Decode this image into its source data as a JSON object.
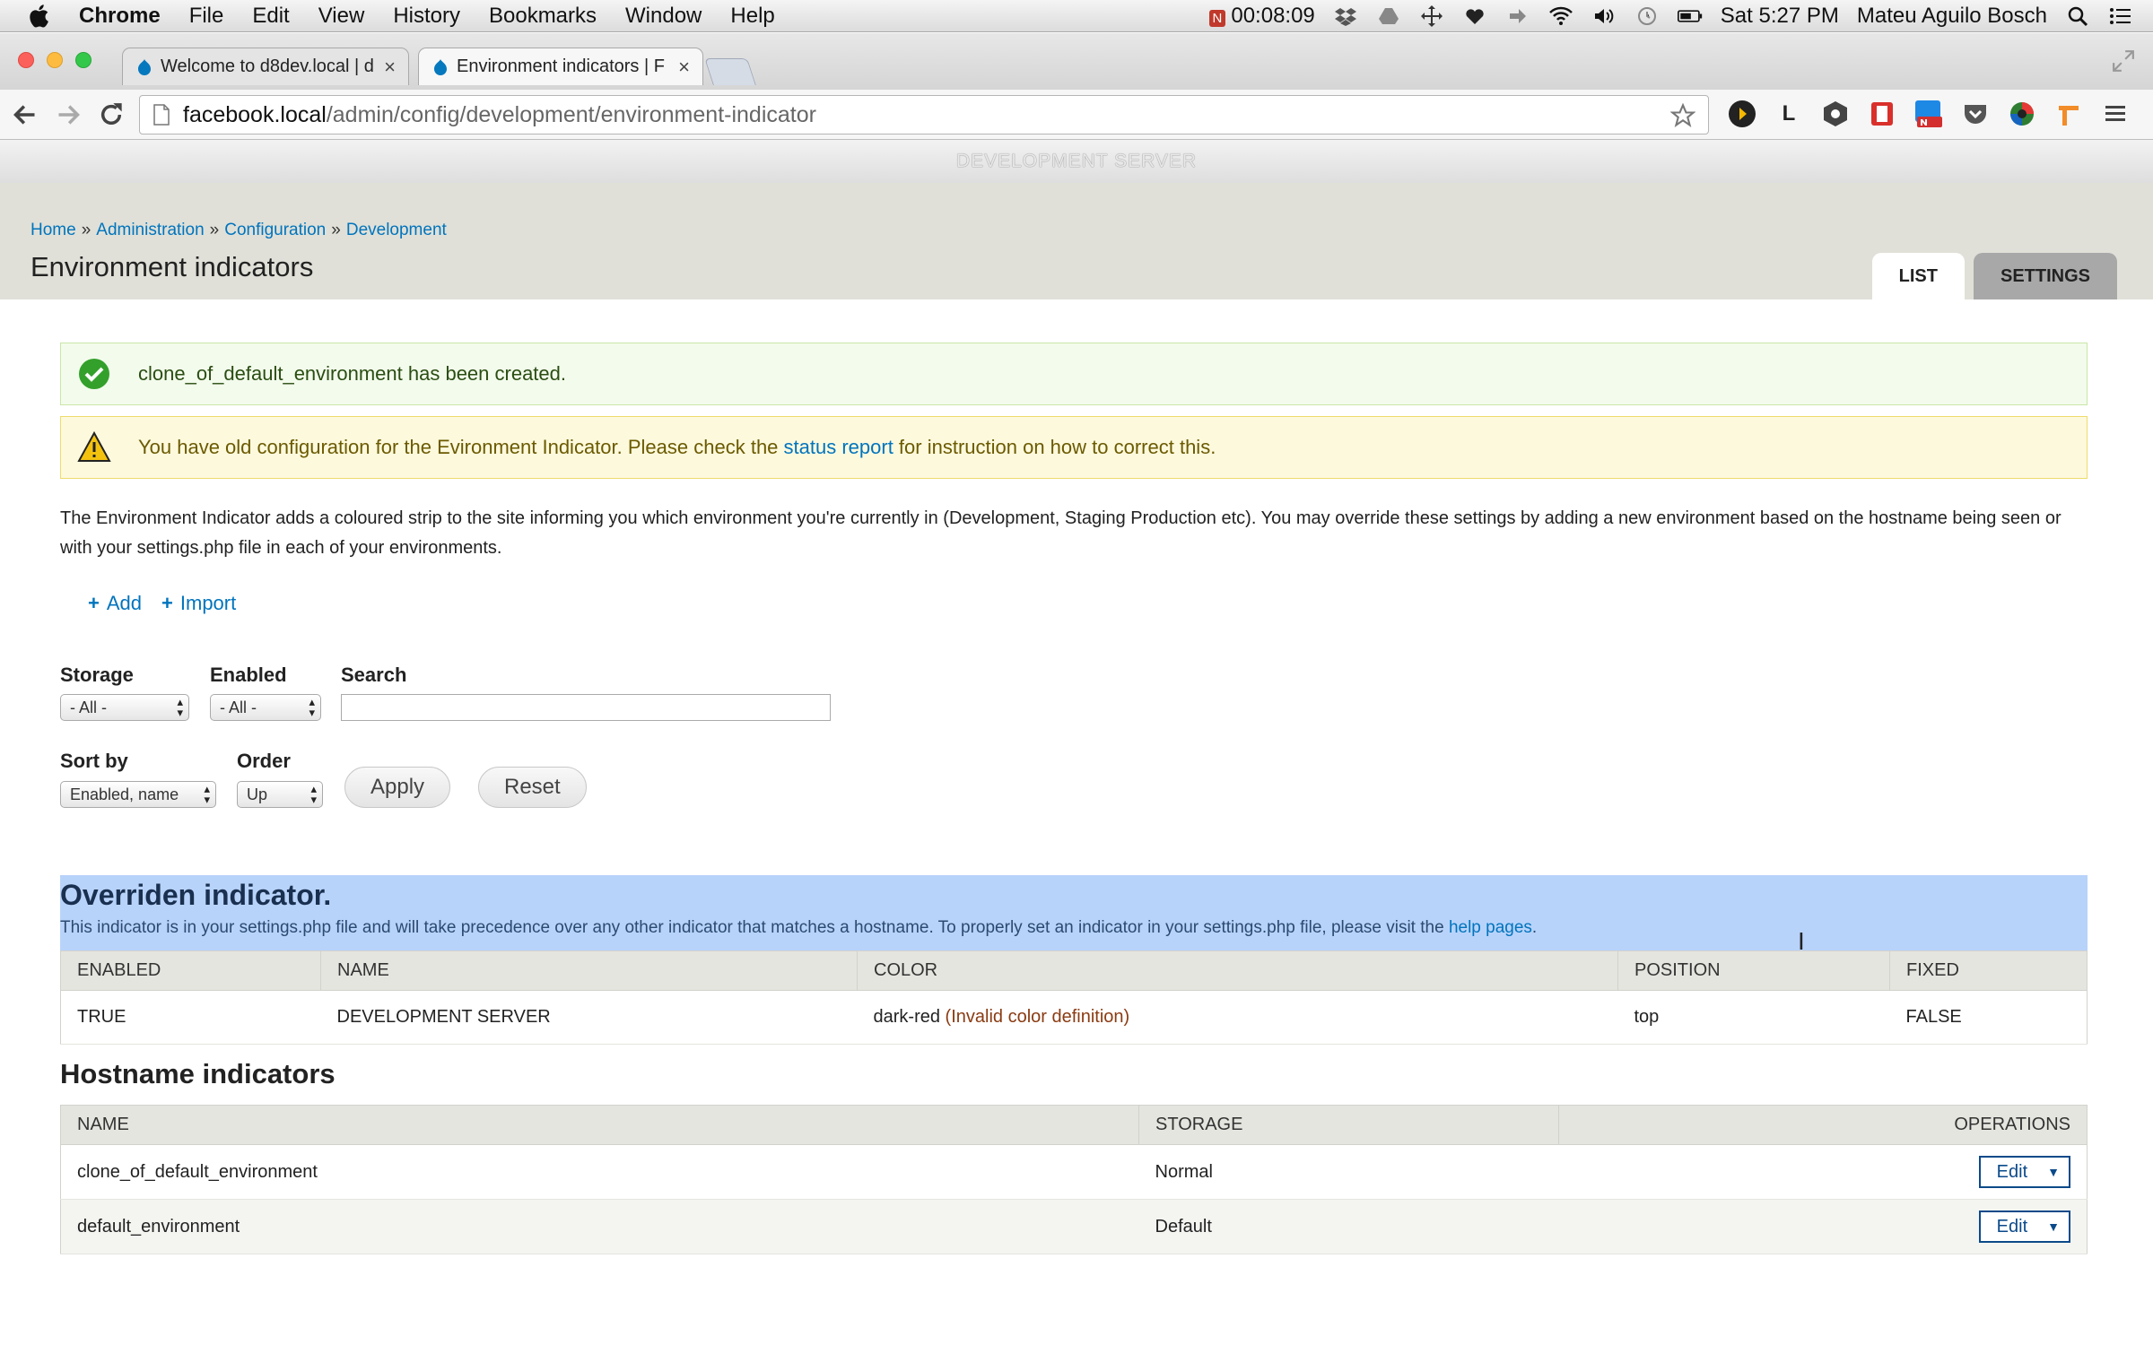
{
  "menubar": {
    "items": [
      "Chrome",
      "File",
      "Edit",
      "View",
      "History",
      "Bookmarks",
      "Window",
      "Help"
    ],
    "rec_label": "N",
    "timer": "00:08:09",
    "clock": "Sat 5:27 PM",
    "user": "Mateu Aguilo Bosch"
  },
  "tabs": [
    {
      "label": "Welcome to d8dev.local | d",
      "active": false
    },
    {
      "label": "Environment indicators | F",
      "active": true
    }
  ],
  "toolbar": {
    "url_host": "facebook.local",
    "url_path": "/admin/config/development/environment-indicator",
    "ext_l": "L"
  },
  "env_strip": "DEVELOPMENT SERVER",
  "breadcrumb": [
    "Home",
    "Administration",
    "Configuration",
    "Development"
  ],
  "breadcrumb_sep": "»",
  "page_title": "Environment indicators",
  "primary_tabs": [
    "LIST",
    "SETTINGS"
  ],
  "messages": {
    "status": "clone_of_default_environment has been created.",
    "warning_pre": "You have old configuration for the Evironment Indicator. Please check the ",
    "warning_link": "status report",
    "warning_post": " for instruction on how to correct this."
  },
  "description": "The Environment Indicator adds a coloured strip to the site informing you which environment you're currently in (Development, Staging Production etc). You may override these settings by adding a new environment based on the hostname being seen or with your settings.php file in each of your environments.",
  "actions": {
    "plus": "+",
    "add": "Add",
    "import": "Import"
  },
  "filters": {
    "storage_label": "Storage",
    "storage_value": "- All -",
    "enabled_label": "Enabled",
    "enabled_value": "- All -",
    "search_label": "Search",
    "search_value": "",
    "sort_label": "Sort by",
    "sort_value": "Enabled, name",
    "order_label": "Order",
    "order_value": "Up",
    "apply": "Apply",
    "reset": "Reset"
  },
  "overridden": {
    "title": "Overriden indicator.",
    "desc_pre": "This indicator is in your settings.php file and will take precedence over any other indicator that matches a hostname. To properly set an indicator in your settings.php file, please visit the ",
    "desc_link": "help pages",
    "desc_post": ".",
    "headers": [
      "Enabled",
      "Name",
      "Color",
      "Position",
      "Fixed"
    ],
    "row": {
      "enabled": "TRUE",
      "name": "DEVELOPMENT SERVER",
      "color": "dark-red",
      "color_note": "(Invalid color definition)",
      "position": "top",
      "fixed": "FALSE"
    }
  },
  "hostname": {
    "title": "Hostname indicators",
    "headers": [
      "Name",
      "Storage",
      "Operations"
    ],
    "rows": [
      {
        "name": "clone_of_default_environment",
        "storage": "Normal",
        "op": "Edit"
      },
      {
        "name": "default_environment",
        "storage": "Default",
        "op": "Edit"
      }
    ]
  },
  "colors": {
    "link": "#0074bd",
    "status_bg": "#f3fbec",
    "warning_bg": "#fdf9dd",
    "overridden_bg": "#b8d3fa"
  },
  "icons": [
    "apple-icon",
    "back-icon",
    "forward-icon",
    "reload-icon",
    "star-icon",
    "success-icon",
    "warning-icon"
  ]
}
